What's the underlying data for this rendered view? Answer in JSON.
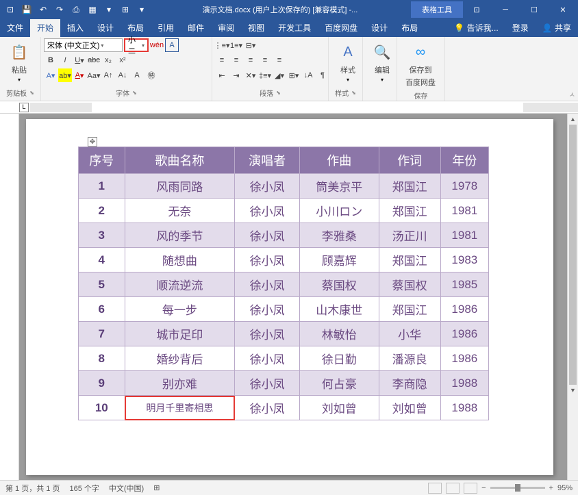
{
  "title": "演示文档.docx (用户上次保存的) [兼容模式] -...",
  "contextTab": "表格工具",
  "tabs": {
    "file": "文件",
    "home": "开始",
    "insert": "插入",
    "design": "设计",
    "layout": "布局",
    "references": "引用",
    "mailings": "邮件",
    "review": "审阅",
    "view": "视图",
    "developer": "开发工具",
    "baidu": "百度网盘",
    "tblDesign": "设计",
    "tblLayout": "布局",
    "tellMe": "告诉我...",
    "login": "登录",
    "share": "共享"
  },
  "ribbon": {
    "clipboard": {
      "label": "剪贴板",
      "paste": "粘贴"
    },
    "font": {
      "label": "字体",
      "family": "宋体 (中文正文)",
      "size": "小二"
    },
    "paragraph": {
      "label": "段落"
    },
    "styles": {
      "label": "样式",
      "btn": "样式"
    },
    "editing": {
      "label": "编辑"
    },
    "save": {
      "label": "保存",
      "btn1": "保存到",
      "btn2": "百度网盘"
    }
  },
  "table": {
    "headers": [
      "序号",
      "歌曲名称",
      "演唱者",
      "作曲",
      "作词",
      "年份"
    ],
    "rows": [
      [
        "1",
        "风雨同路",
        "徐小凤",
        "筒美京平",
        "郑国江",
        "1978"
      ],
      [
        "2",
        "无奈",
        "徐小凤",
        "小川ロン",
        "郑国江",
        "1981"
      ],
      [
        "3",
        "风的季节",
        "徐小凤",
        "李雅桑",
        "汤正川",
        "1981"
      ],
      [
        "4",
        "随想曲",
        "徐小凤",
        "顾嘉辉",
        "郑国江",
        "1983"
      ],
      [
        "5",
        "顺流逆流",
        "徐小凤",
        "蔡国权",
        "蔡国权",
        "1985"
      ],
      [
        "6",
        "每一步",
        "徐小凤",
        "山木康世",
        "郑国江",
        "1986"
      ],
      [
        "7",
        "城市足印",
        "徐小凤",
        "林敏怡",
        "小华",
        "1986"
      ],
      [
        "8",
        "婚纱背后",
        "徐小凤",
        "徐日勤",
        "潘源良",
        "1986"
      ],
      [
        "9",
        "别亦难",
        "徐小凤",
        "何占豪",
        "李商隐",
        "1988"
      ],
      [
        "10",
        "明月千里寄相思",
        "徐小凤",
        "刘如曾",
        "刘如曾",
        "1988"
      ]
    ],
    "highlightCell": {
      "row": 9,
      "col": 1
    }
  },
  "status": {
    "page": "第 1 页，共 1 页",
    "words": "165 个字",
    "lang": "中文(中国)",
    "zoom": "95%"
  }
}
